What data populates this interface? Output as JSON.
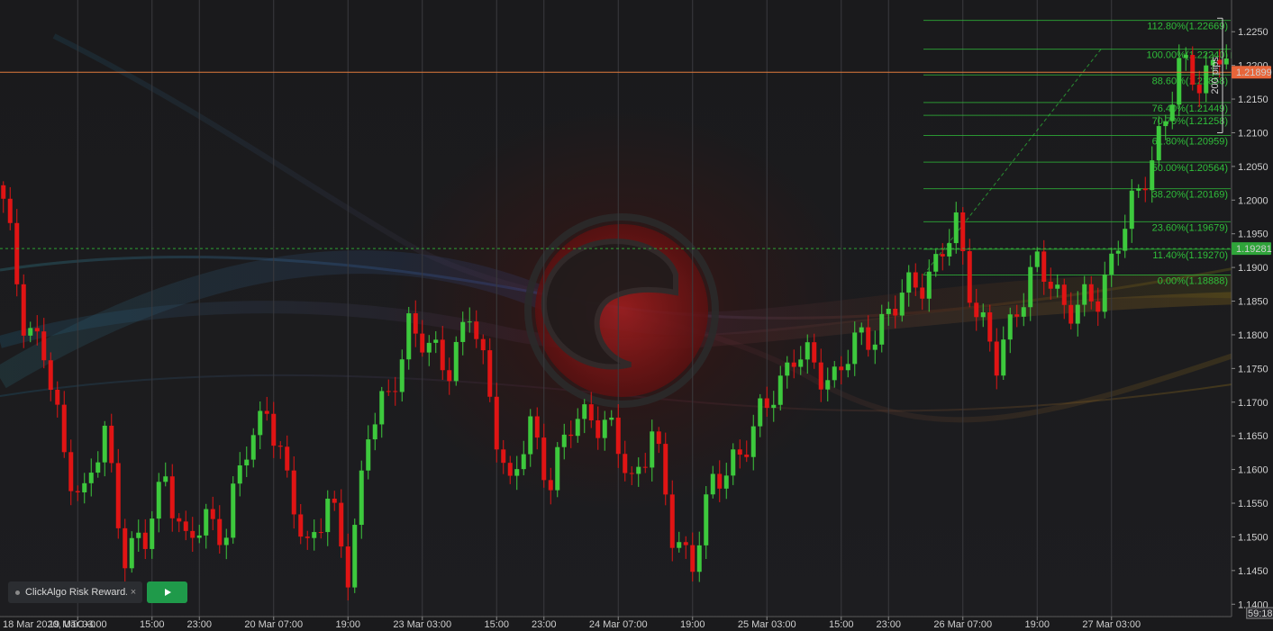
{
  "chart_data": {
    "type": "candlestick",
    "timezone_label": "18 Mar 2020, UTC+0",
    "x_labels": [
      "18 Mar 2020, UTC+0",
      "19 Mar 03:00",
      "15:00",
      "23:00",
      "20 Mar 07:00",
      "19:00",
      "23 Mar 03:00",
      "15:00",
      "23:00",
      "24 Mar 07:00",
      "19:00",
      "25 Mar 03:00",
      "15:00",
      "23:00",
      "26 Mar 07:00",
      "19:00",
      "27 Mar 03:00"
    ],
    "x_label_slots": [
      0,
      11,
      22,
      29,
      40,
      51,
      62,
      73,
      80,
      91,
      102,
      113,
      124,
      131,
      142,
      153,
      164
    ],
    "y_ticks": [
      "1.2250",
      "1.2200",
      "1.2150",
      "1.2100",
      "1.2050",
      "1.2000",
      "1.1950",
      "1.1900",
      "1.1850",
      "1.1800",
      "1.1750",
      "1.1700",
      "1.1650",
      "1.1600",
      "1.1550",
      "1.1500",
      "1.1450",
      "1.1400"
    ],
    "ylim": [
      1.1395,
      1.2265
    ],
    "current_price": "1.21899",
    "current_price_value": 1.21899,
    "line_price": "1.19281",
    "line_price_value": 1.19281,
    "countdown": "59:18",
    "ruler_label": "200 pips",
    "ruler_range": [
      1.21,
      1.227
    ],
    "fibonacci": [
      {
        "label": "112.80%(1.22669)",
        "value": 1.22669
      },
      {
        "label": "100.00%(1.22240)",
        "value": 1.2224
      },
      {
        "label": "88.60%(1.21858)",
        "value": 1.21858
      },
      {
        "label": "76.40%(1.21449)",
        "value": 1.21449
      },
      {
        "label": "70.70%(1.21258)",
        "value": 1.21258
      },
      {
        "label": "61.80%(1.20959)",
        "value": 1.20959
      },
      {
        "label": "50.00%(1.20564)",
        "value": 1.20564
      },
      {
        "label": "38.20%(1.20169)",
        "value": 1.20169
      },
      {
        "label": "23.60%(1.19679)",
        "value": 1.19679
      },
      {
        "label": "11.40%(1.19270)",
        "value": 1.1927
      },
      {
        "label": "0.00%(1.18888)",
        "value": 1.18888
      }
    ],
    "close_anchors": [
      [
        0,
        1.199
      ],
      [
        3,
        1.183
      ],
      [
        6,
        1.177
      ],
      [
        9,
        1.162
      ],
      [
        12,
        1.156
      ],
      [
        15,
        1.165
      ],
      [
        18,
        1.148
      ],
      [
        21,
        1.149
      ],
      [
        24,
        1.16
      ],
      [
        27,
        1.148
      ],
      [
        30,
        1.153
      ],
      [
        33,
        1.151
      ],
      [
        36,
        1.163
      ],
      [
        39,
        1.17
      ],
      [
        42,
        1.157
      ],
      [
        45,
        1.149
      ],
      [
        48,
        1.155
      ],
      [
        51,
        1.145
      ],
      [
        54,
        1.166
      ],
      [
        57,
        1.17
      ],
      [
        60,
        1.182
      ],
      [
        63,
        1.177
      ],
      [
        66,
        1.176
      ],
      [
        69,
        1.183
      ],
      [
        72,
        1.171
      ],
      [
        75,
        1.157
      ],
      [
        78,
        1.166
      ],
      [
        81,
        1.159
      ],
      [
        84,
        1.166
      ],
      [
        87,
        1.169
      ],
      [
        90,
        1.165
      ],
      [
        93,
        1.158
      ],
      [
        96,
        1.166
      ],
      [
        99,
        1.15
      ],
      [
        102,
        1.147
      ],
      [
        105,
        1.157
      ],
      [
        108,
        1.162
      ],
      [
        111,
        1.165
      ],
      [
        114,
        1.172
      ],
      [
        117,
        1.177
      ],
      [
        120,
        1.175
      ],
      [
        123,
        1.174
      ],
      [
        126,
        1.178
      ],
      [
        129,
        1.181
      ],
      [
        132,
        1.184
      ],
      [
        135,
        1.188
      ],
      [
        138,
        1.19
      ],
      [
        141,
        1.196
      ],
      [
        144,
        1.184
      ],
      [
        147,
        1.175
      ],
      [
        150,
        1.185
      ],
      [
        153,
        1.19
      ],
      [
        156,
        1.186
      ],
      [
        159,
        1.184
      ],
      [
        162,
        1.185
      ],
      [
        165,
        1.195
      ],
      [
        168,
        1.2
      ],
      [
        171,
        1.21
      ],
      [
        174,
        1.219
      ],
      [
        177,
        1.218
      ],
      [
        180,
        1.222
      ],
      [
        183,
        1.217
      ],
      [
        186,
        1.219
      ]
    ],
    "bot": {
      "name": "ClickAlgo Risk Reward...",
      "close": "×"
    },
    "colors": {
      "bull": "#3dc93d",
      "bear": "#e01414",
      "fib": "#2fbf3a",
      "price_line": "#e07a3c",
      "green_line": "#33c23a",
      "background": "#1b1b1d"
    }
  }
}
